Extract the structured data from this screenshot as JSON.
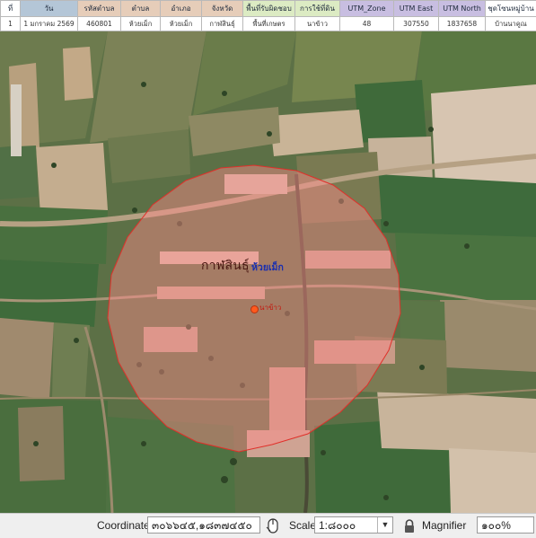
{
  "attribute_table": {
    "headers": [
      {
        "label": "ที่",
        "color": "#ffffff"
      },
      {
        "label": "วัน",
        "color": "#b4c6d7"
      },
      {
        "label": "รหัสตำบล",
        "color": "#e6cdb9"
      },
      {
        "label": "ตำบล",
        "color": "#e6cdb9"
      },
      {
        "label": "อำเภอ",
        "color": "#e6cdb9"
      },
      {
        "label": "จังหวัด",
        "color": "#e6cdb9"
      },
      {
        "label": "พื้นที่รับผิดชอบ",
        "color": "#dcebc3"
      },
      {
        "label": "การใช้ที่ดิน",
        "color": "#dcebc3"
      },
      {
        "label": "UTM_Zone",
        "color": "#c8bee1"
      },
      {
        "label": "UTM East",
        "color": "#c8bee1"
      },
      {
        "label": "UTM North",
        "color": "#c8bee1"
      },
      {
        "label": "ชุดโซนหมู่บ้าน",
        "color": "#ffffff"
      }
    ],
    "rows": [
      [
        "1",
        "1 มกราคม 2569",
        "460801",
        "ห้วยเม็ก",
        "ห้วยเม็ก",
        "กาฬสินธุ์",
        "พื้นที่เกษตร",
        "นาข้าว",
        "48",
        "307550",
        "1837658",
        "บ้านนาคูณ"
      ]
    ]
  },
  "map": {
    "labels": {
      "district": "กาฬสินธุ์",
      "village": "ห้วยเม็ก",
      "point": "นาข้าว"
    },
    "buffer_fill": "#ff8c8c",
    "buffer_stroke": "#e0302a",
    "point_color": "#ff5a1e"
  },
  "status_bar": {
    "coordinate_label": "Coordinate",
    "coordinate_value": "๓๐๖๖๔๕,๑๘๓๗๔๕๐",
    "scale_label": "Scale",
    "scale_value": "1:๘๐๐๐",
    "magnifier_label": "Magnifier",
    "magnifier_value": "๑๐๐%",
    "icons": [
      "mouse-icon",
      "chevron-down-icon",
      "lock-icon"
    ]
  }
}
